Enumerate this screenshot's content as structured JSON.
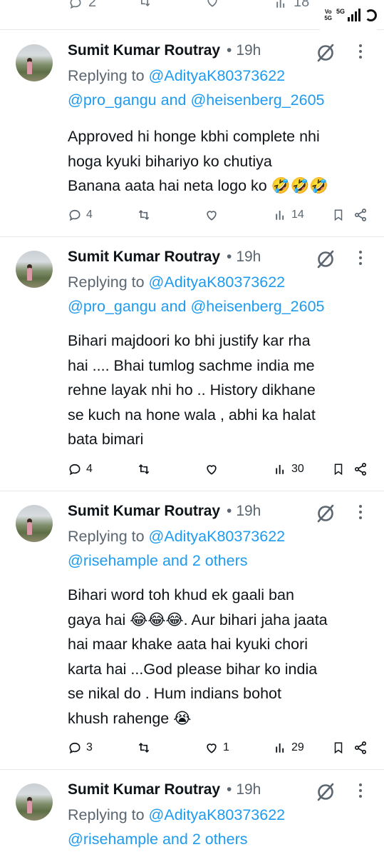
{
  "top_bar": {
    "reply_count": "2",
    "view_count": "18",
    "status": {
      "volte": "Vo\n5G",
      "network": "5G"
    }
  },
  "tweets": [
    {
      "name": "Sumit Kumar Routray",
      "time": "19h",
      "replying_prefix": "Replying to ",
      "replying_mention_1": "@AdityaK80373622",
      "replying_mention_2": "@pro_gangu",
      "replying_and": " and ",
      "replying_mention_3": "@heisenberg_2605",
      "text": "Approved hi honge kbhi complete nhi\nhoga kyuki bihariyo ko chutiya\nBanana aata hai neta logo ko 🤣🤣🤣",
      "replies": "4",
      "reposts": "",
      "likes": "",
      "views": "14"
    },
    {
      "name": "Sumit Kumar Routray",
      "time": "19h",
      "replying_prefix": "Replying to ",
      "replying_mention_1": "@AdityaK80373622",
      "replying_mention_2": "@pro_gangu",
      "replying_and": " and ",
      "replying_mention_3": "@heisenberg_2605",
      "text": "Bihari majdoori ko bhi justify kar rha\nhai .... Bhai tumlog sachme india me\nrehne layak nhi ho .. History dikhane\nse kuch na hone wala , abhi ka halat\nbata bimari",
      "replies": "4",
      "reposts": "",
      "likes": "",
      "views": "30"
    },
    {
      "name": "Sumit Kumar Routray",
      "time": "19h",
      "replying_prefix": "Replying to ",
      "replying_mention_1": "@AdityaK80373622",
      "replying_mention_2": "@risehample",
      "replying_and": " and ",
      "replying_mention_3": "2 others",
      "text": "Bihari word toh khud ek gaali ban\ngaya hai 😂😂😂. Aur bihari jaha jaata\nhai maar khake aata hai kyuki chori\nkarta hai ...God please bihar ko india\nse nikal do . Hum indians bohot\nkhush rahenge 😭",
      "replies": "3",
      "reposts": "",
      "likes": "1",
      "views": "29"
    },
    {
      "name": "Sumit Kumar Routray",
      "time": "19h",
      "replying_prefix": "Replying to ",
      "replying_mention_1": "@AdityaK80373622",
      "replying_mention_2": "@risehample",
      "replying_and": " and ",
      "replying_mention_3": "2 others",
      "text": "",
      "replies": "",
      "reposts": "",
      "likes": "",
      "views": ""
    }
  ],
  "colors": {
    "accent": "#1d9bf0",
    "muted": "#5b6670",
    "text": "#0f1419",
    "divider": "#e6e8ea"
  },
  "icons": [
    "reply-icon",
    "repost-icon",
    "like-icon",
    "views-icon",
    "bookmark-icon",
    "share-icon",
    "grok-icon",
    "more-icon"
  ]
}
